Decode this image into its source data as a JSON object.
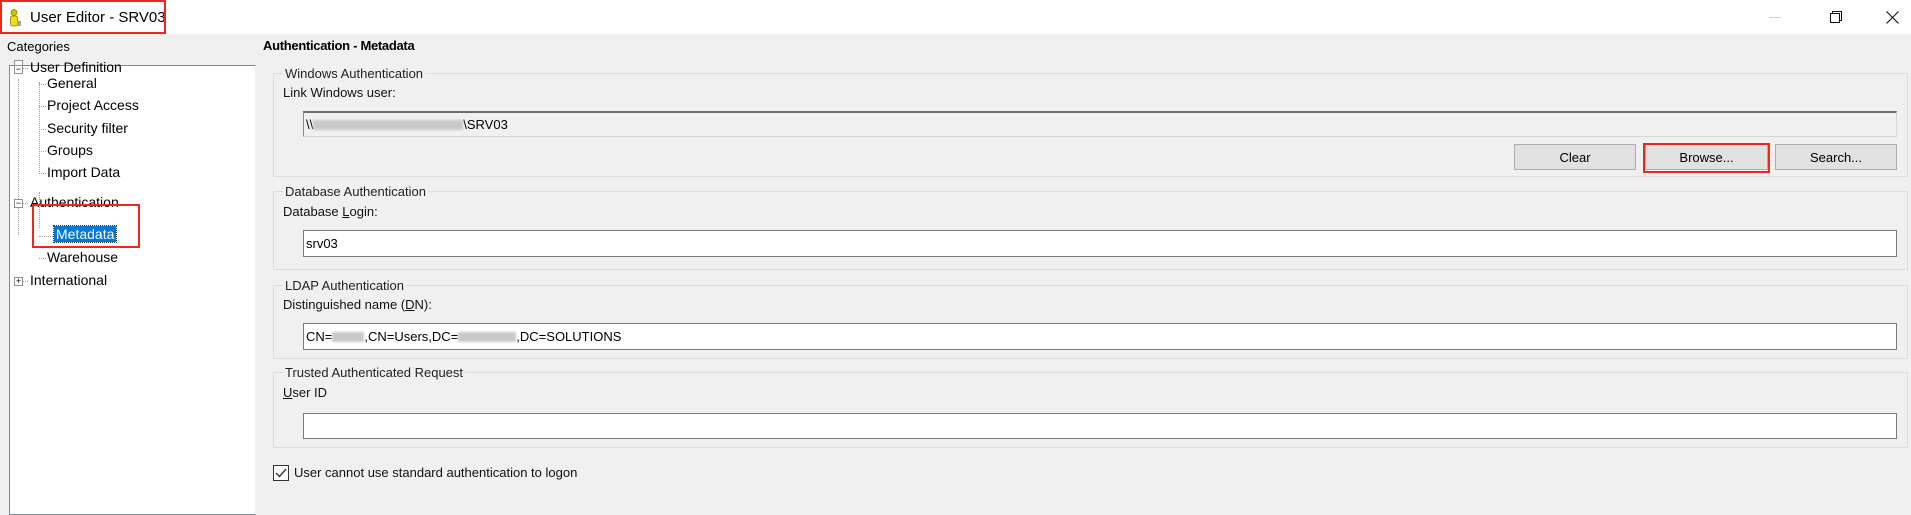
{
  "window": {
    "title": "User Editor - SRV03",
    "icon": "user-icon",
    "controls": {
      "minimize": "minimize-icon",
      "restore": "restore-icon",
      "close": "close-icon"
    }
  },
  "sidebar": {
    "label": "Categories",
    "tree": [
      {
        "label": "User Definition",
        "expanded": true,
        "children": [
          "General",
          "Project Access",
          "Security filter",
          "Groups",
          "Import Data"
        ]
      },
      {
        "label": "Authentication",
        "expanded": true,
        "children": [
          "Metadata",
          "Warehouse"
        ],
        "selected_child": "Metadata"
      },
      {
        "label": "International",
        "expanded": false,
        "children": []
      }
    ]
  },
  "main": {
    "title": "Authentication - Metadata",
    "windows_auth": {
      "legend": "Windows Authentication",
      "label": "Link Windows user:",
      "value_prefix": "\\\\",
      "value_suffix": "\\SRV03",
      "buttons": {
        "clear": "Clear",
        "browse": "Browse...",
        "search": "Search..."
      }
    },
    "database_auth": {
      "legend": "Database Authentication",
      "label_pre": "Database ",
      "label_accel": "L",
      "label_post": "ogin:",
      "value": "srv03"
    },
    "ldap_auth": {
      "legend": "LDAP Authentication",
      "label_pre": "Distinguished name (",
      "label_accel": "D",
      "label_post": "N):",
      "value_part1": "CN=",
      "value_part2": ",CN=Users,DC=",
      "value_part3": ",DC=SOLUTIONS"
    },
    "trusted_auth": {
      "legend": "Trusted Authenticated Request",
      "label_accel": "U",
      "label_post": "ser ID",
      "value": ""
    },
    "standard_auth_checkbox": {
      "label": "User cannot use standard authentication to logon",
      "checked": true
    }
  },
  "colors": {
    "highlight_border": "#e8291c",
    "selection": "#0078d7"
  }
}
